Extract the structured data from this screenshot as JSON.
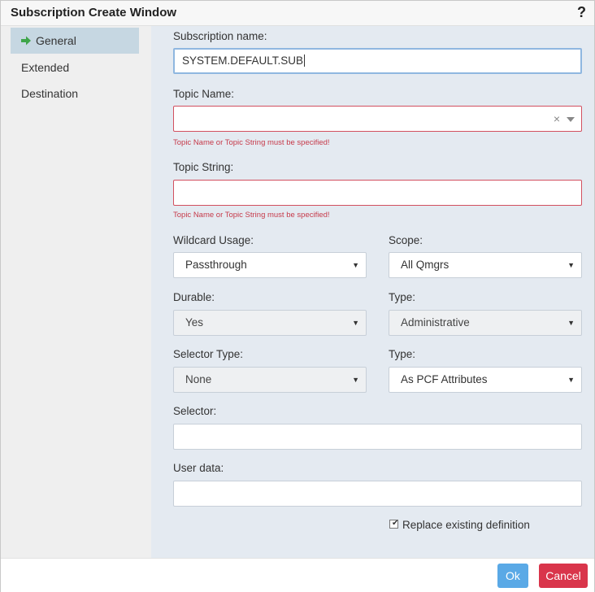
{
  "window": {
    "title": "Subscription Create Window",
    "help_label": "?"
  },
  "sidebar": {
    "items": [
      {
        "label": "General",
        "active": true
      },
      {
        "label": "Extended",
        "active": false
      },
      {
        "label": "Destination",
        "active": false
      }
    ]
  },
  "form": {
    "subscription_name": {
      "label": "Subscription name:",
      "value": "SYSTEM.DEFAULT.SUB"
    },
    "topic_name": {
      "label": "Topic Name:",
      "value": "",
      "clear_glyph": "×",
      "error": "Topic Name or Topic String must be specified!"
    },
    "topic_string": {
      "label": "Topic String:",
      "value": "",
      "error": "Topic Name or Topic String must be specified!"
    },
    "wildcard_usage": {
      "label": "Wildcard Usage:",
      "value": "Passthrough"
    },
    "scope": {
      "label": "Scope:",
      "value": "All Qmgrs"
    },
    "durable": {
      "label": "Durable:",
      "value": "Yes"
    },
    "type_admin": {
      "label": "Type:",
      "value": "Administrative"
    },
    "selector_type": {
      "label": "Selector Type:",
      "value": "None"
    },
    "type_pcf": {
      "label": "Type:",
      "value": "As PCF Attributes"
    },
    "selector": {
      "label": "Selector:",
      "value": ""
    },
    "user_data": {
      "label": "User data:",
      "value": ""
    },
    "replace_existing": {
      "label": "Replace existing definition",
      "checked": true,
      "tick": "✔"
    },
    "caret_glyph": "▼"
  },
  "footer": {
    "ok_label": "Ok",
    "cancel_label": "Cancel"
  },
  "colors": {
    "accent": "#5aa9e6",
    "danger": "#d9354b",
    "error_text": "#c63a4a",
    "nav_active": "#c6d7e2",
    "arrow": "#3fa54a"
  }
}
